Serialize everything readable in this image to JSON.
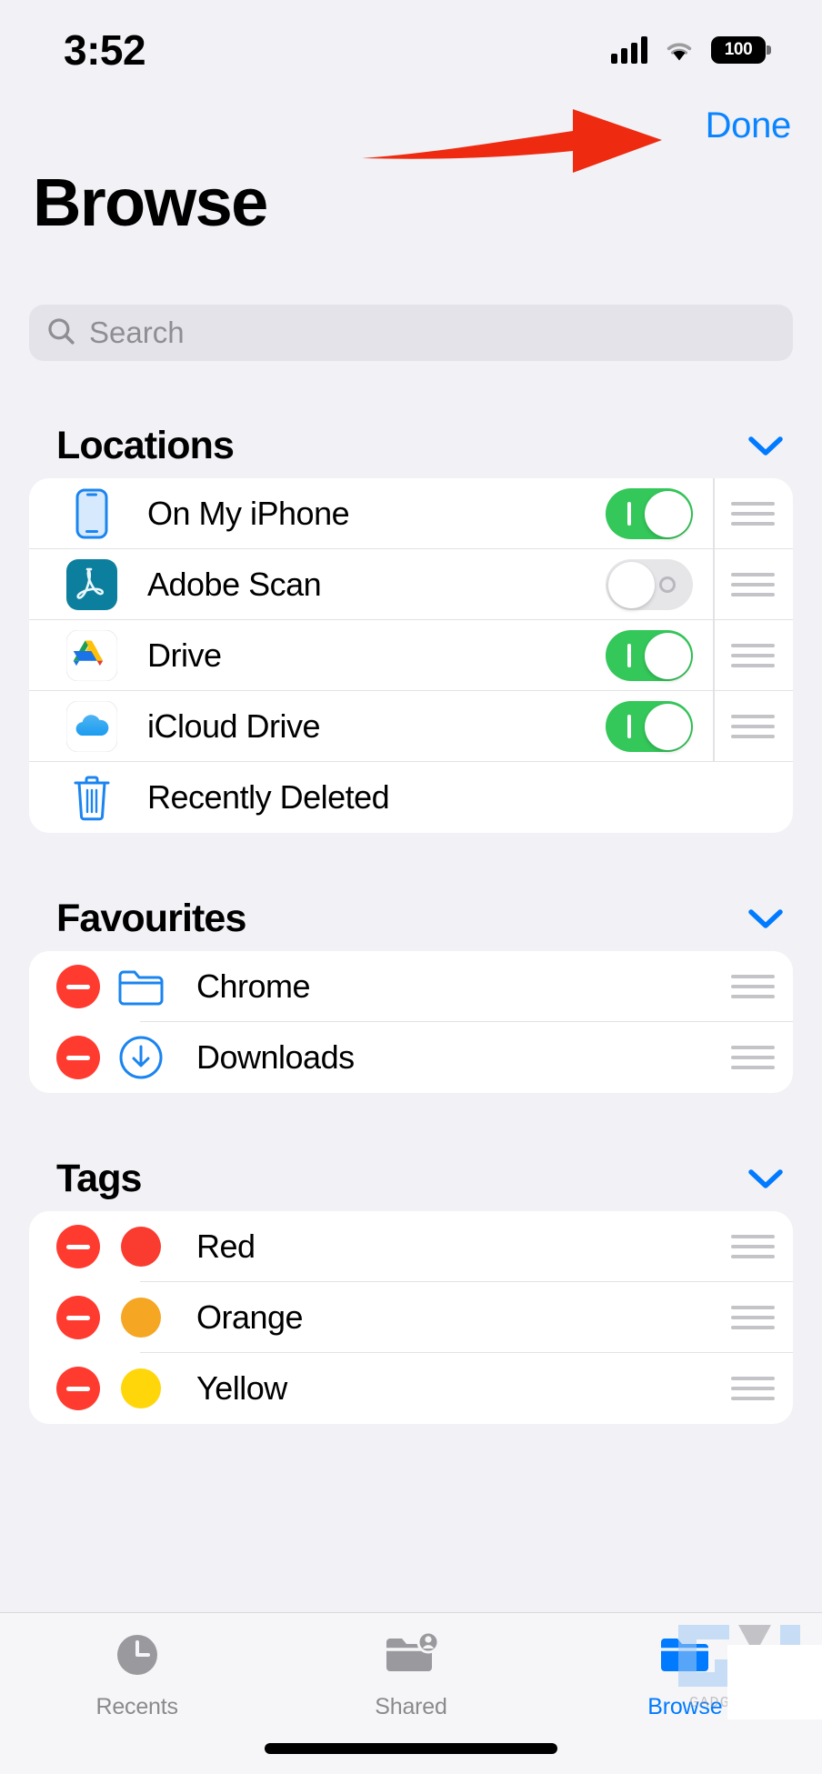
{
  "status_bar": {
    "time": "3:52",
    "battery_level": "100",
    "cellular_icon": "cellular-bars-icon",
    "wifi_icon": "wifi-icon",
    "battery_icon": "battery-icon"
  },
  "nav": {
    "done_label": "Done",
    "annotation_arrow": "red-arrow-annotation"
  },
  "header": {
    "title": "Browse"
  },
  "search": {
    "placeholder": "Search",
    "value": "",
    "icon": "search-icon"
  },
  "colors": {
    "accent_blue": "#007aff",
    "link_blue": "#0a84ff",
    "toggle_on_green": "#34c759",
    "delete_red": "#ff3b30",
    "tag_red": "#fa3b2f",
    "tag_orange": "#f5a623",
    "tag_yellow": "#ffd60a",
    "background": "#f1f1f6",
    "card": "#ffffff"
  },
  "sections": [
    {
      "title": "Locations",
      "collapse_icon": "chevron-down-icon",
      "rows": [
        {
          "label": "On My iPhone",
          "icon": "iphone-icon",
          "toggle": "on",
          "handle": true
        },
        {
          "label": "Adobe Scan",
          "icon": "adobe-scan-icon",
          "toggle": "off",
          "handle": true
        },
        {
          "label": "Drive",
          "icon": "google-drive-icon",
          "toggle": "on",
          "handle": true
        },
        {
          "label": "iCloud Drive",
          "icon": "icloud-drive-icon",
          "toggle": "on",
          "handle": true
        },
        {
          "label": "Recently Deleted",
          "icon": "trash-icon",
          "toggle": null,
          "handle": false
        }
      ]
    },
    {
      "title": "Favourites",
      "collapse_icon": "chevron-down-icon",
      "rows": [
        {
          "label": "Chrome",
          "icon": "folder-outline-icon",
          "remove": true,
          "handle": true
        },
        {
          "label": "Downloads",
          "icon": "download-circle-icon",
          "remove": true,
          "handle": true
        }
      ]
    },
    {
      "title": "Tags",
      "collapse_icon": "chevron-down-icon",
      "rows": [
        {
          "label": "Red",
          "icon": "tag-dot-red",
          "dot": "#fa3b2f",
          "remove": true,
          "handle": true
        },
        {
          "label": "Orange",
          "icon": "tag-dot-orange",
          "dot": "#f5a623",
          "remove": true,
          "handle": true
        },
        {
          "label": "Yellow",
          "icon": "tag-dot-yellow",
          "dot": "#ffd60a",
          "remove": true,
          "handle": true
        }
      ]
    }
  ],
  "tab_bar": {
    "tabs": [
      {
        "label": "Recents",
        "icon": "clock-icon",
        "active": false
      },
      {
        "label": "Shared",
        "icon": "shared-folder-icon",
        "active": false
      },
      {
        "label": "Browse",
        "icon": "folder-filled-icon",
        "active": true
      }
    ]
  },
  "watermark": {
    "text": "GADGE"
  }
}
